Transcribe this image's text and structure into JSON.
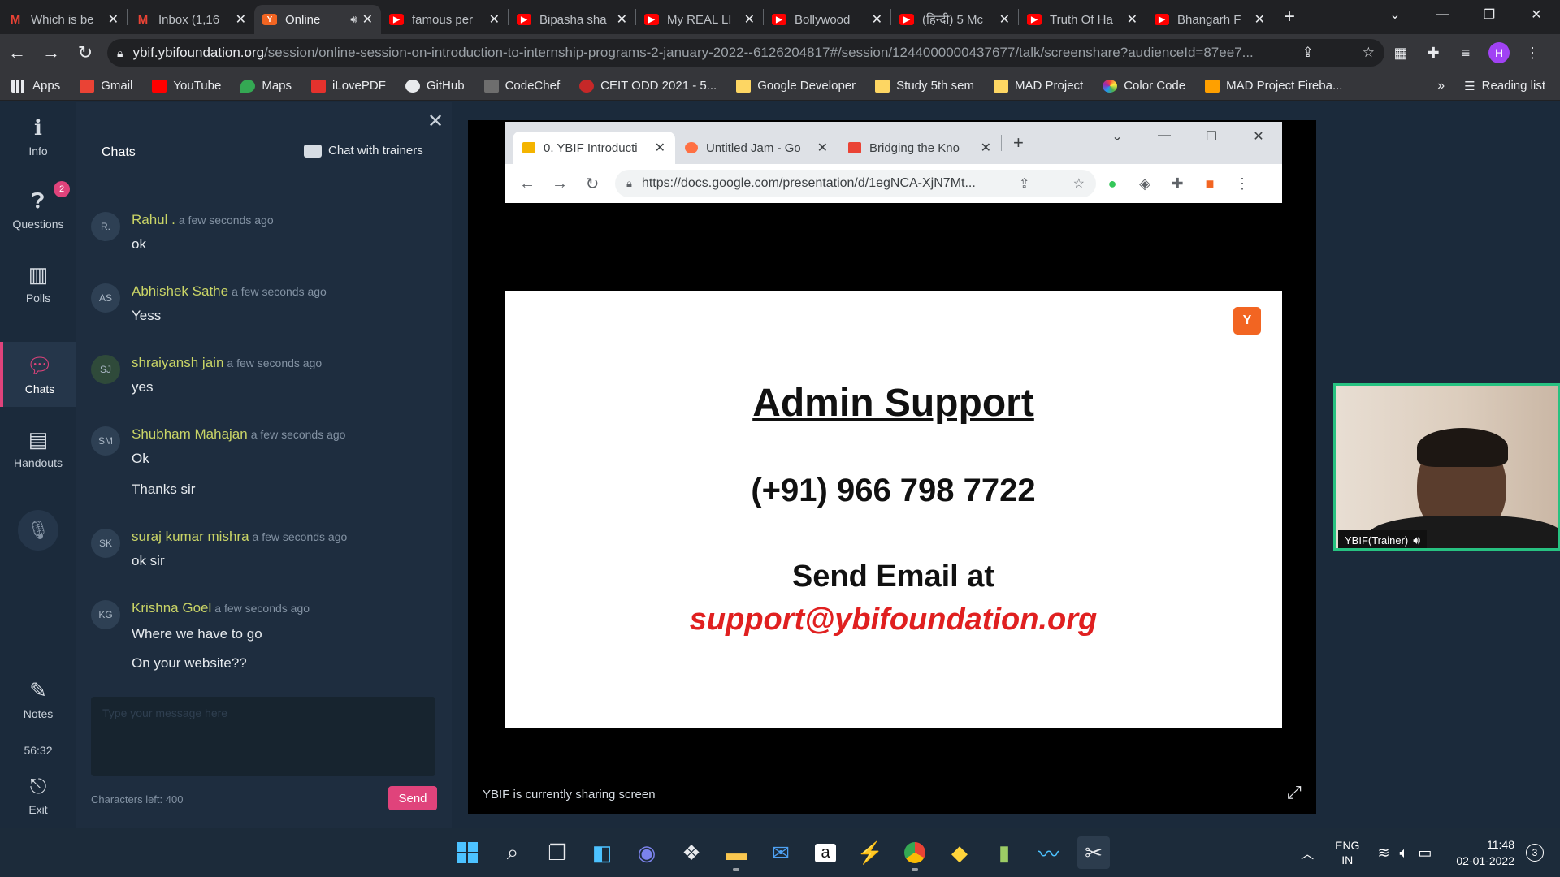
{
  "browser": {
    "tabs": [
      {
        "label": "Which is be",
        "icon": "gmail-icon"
      },
      {
        "label": "Inbox (1,16",
        "icon": "gmail-icon"
      },
      {
        "label": "Online",
        "icon": "ybif-icon",
        "active": true
      },
      {
        "label": "famous per",
        "icon": "youtube-icon"
      },
      {
        "label": "Bipasha sha",
        "icon": "youtube-icon"
      },
      {
        "label": "My REAL LI",
        "icon": "youtube-icon"
      },
      {
        "label": "Bollywood",
        "icon": "youtube-icon"
      },
      {
        "label": "(हिन्दी) 5 Mc",
        "icon": "youtube-icon"
      },
      {
        "label": "Truth Of Ha",
        "icon": "youtube-icon"
      },
      {
        "label": "Bhangarh F",
        "icon": "youtube-icon"
      }
    ],
    "url_host": "ybif.ybifoundation.org",
    "url_path": "/session/online-session-on-introduction-to-internship-programs-2-january-2022--6126204817#/session/1244000000437677/talk/screenshare?audienceId=87ee7...",
    "profile_initial": "H",
    "bookmarks": [
      {
        "label": "Apps",
        "icon": "apps"
      },
      {
        "label": "Gmail",
        "icon": "gm"
      },
      {
        "label": "YouTube",
        "icon": "yt"
      },
      {
        "label": "Maps",
        "icon": "maps"
      },
      {
        "label": "iLovePDF",
        "icon": "ilove"
      },
      {
        "label": "GitHub",
        "icon": "gh"
      },
      {
        "label": "CodeChef",
        "icon": "cc"
      },
      {
        "label": "CEIT ODD 2021 - 5...",
        "icon": "ceit"
      },
      {
        "label": "Google Developer",
        "icon": "folder"
      },
      {
        "label": "Study 5th sem",
        "icon": "folder"
      },
      {
        "label": "MAD Project",
        "icon": "folder"
      },
      {
        "label": "Color Code",
        "icon": "color"
      },
      {
        "label": "MAD Project Fireba...",
        "icon": "fire"
      }
    ],
    "bookmarks_more": "»",
    "reading_list": "Reading list"
  },
  "rail": {
    "info": "Info",
    "questions": "Questions",
    "questions_badge": "2",
    "polls": "Polls",
    "chats": "Chats",
    "handouts": "Handouts",
    "notes": "Notes",
    "timer": "56:32",
    "exit": "Exit"
  },
  "chat": {
    "title": "Chats",
    "trainers_label": "Chat with trainers",
    "messages": [
      {
        "initials": "R.",
        "name": "Rahul .",
        "time": "a few seconds ago",
        "lines": [
          "ok"
        ]
      },
      {
        "initials": "AS",
        "name": "Abhishek Sathe",
        "time": "a few seconds ago",
        "lines": [
          "Yess"
        ]
      },
      {
        "initials": "SJ",
        "name": "shraiyansh jain",
        "time": "a few seconds ago",
        "lines": [
          "yes"
        ]
      },
      {
        "initials": "SM",
        "name": "Shubham Mahajan",
        "time": "a few seconds ago",
        "lines": [
          "Ok",
          "Thanks sir"
        ]
      },
      {
        "initials": "SK",
        "name": "suraj kumar mishra",
        "time": "a few seconds ago",
        "lines": [
          "ok sir"
        ]
      },
      {
        "initials": "KG",
        "name": "Krishna Goel",
        "time": "a few seconds ago",
        "lines": [
          "Where we have to go",
          "On your website??"
        ]
      }
    ],
    "input_placeholder": "Type your message here",
    "chars_left": "Characters left: 400",
    "send_label": "Send"
  },
  "stage": {
    "status": "YBIF is currently sharing screen",
    "inner_browser": {
      "tabs": [
        "0. YBIF Introducti",
        "Untitled Jam - Go",
        "Bridging the Kno"
      ],
      "url": "https://docs.google.com/presentation/d/1egNCA-XjN7Mt..."
    },
    "slide": {
      "title": "Admin Support",
      "phone": "(+91) 966 798 7722",
      "send_text": "Send Email at",
      "email": "support@ybifoundation.org"
    }
  },
  "video": {
    "label": "YBIF(Trainer)"
  },
  "taskbar": {
    "lang_top": "ENG",
    "lang_bottom": "IN",
    "time": "11:48",
    "date": "02-01-2022",
    "notifications": "3"
  }
}
